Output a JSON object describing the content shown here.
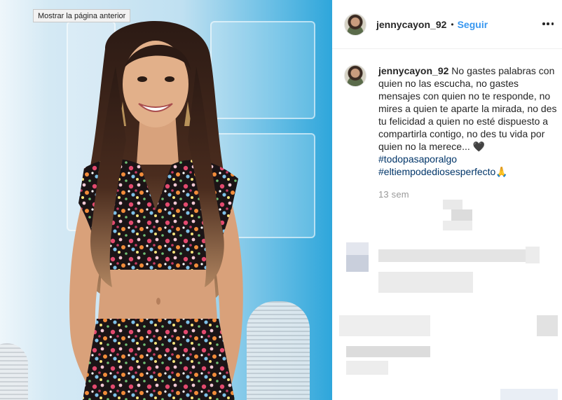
{
  "tooltip": {
    "text": "Mostrar la página anterior"
  },
  "header": {
    "username": "jennycayon_92",
    "separator": "•",
    "follow_label": "Seguir"
  },
  "caption": {
    "username": "jennycayon_92",
    "text": "No gastes palabras con quien no las escucha, no gastes mensajes con quien no te responde, no mires a quien te aparte la mirada, no des tu felicidad a quien no esté dispuesto a compartirla contigo, no des tu vida por quien no la merece...",
    "heart_emoji": "🖤",
    "hashtags": [
      "#todopasaporalgo",
      "#eltiempodediosesperfecto"
    ],
    "pray_emoji": "🙏",
    "time": "13 sem"
  },
  "icons": {
    "more": "more-options-icon",
    "avatar": "profile-avatar"
  },
  "colors": {
    "link_blue": "#3897f0",
    "hashtag_blue": "#003569",
    "muted": "#999999"
  }
}
